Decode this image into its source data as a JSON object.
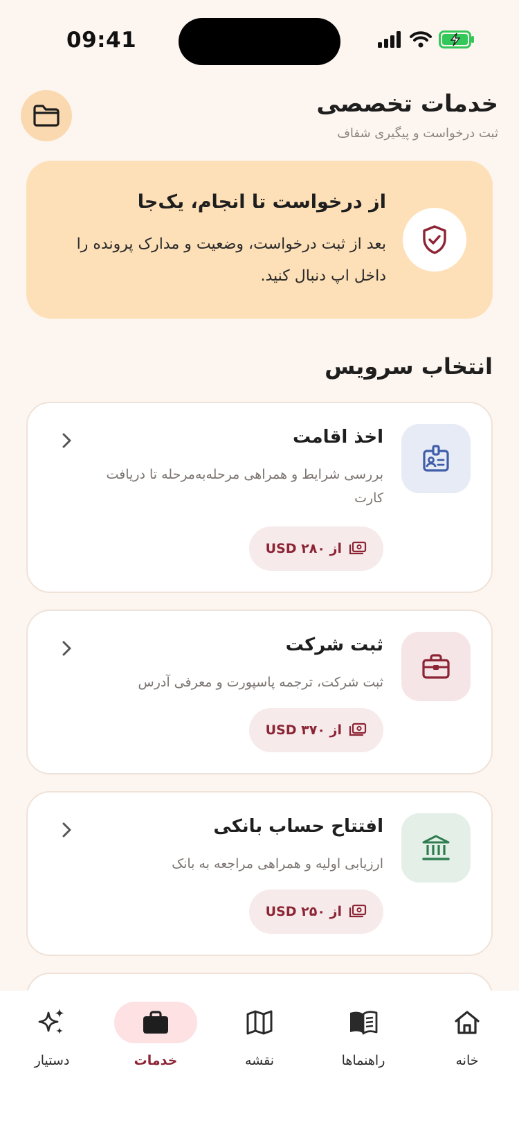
{
  "status": {
    "time": "09:41"
  },
  "header": {
    "title": "خدمات تخصصی",
    "subtitle": "ثبت درخواست و پیگیری شفاف"
  },
  "banner": {
    "title": "از درخواست تا انجام، یک‌جا",
    "text": "بعد از ثبت درخواست، وضعیت و مدارک پرونده را داخل اپ دنبال کنید."
  },
  "section_title": "انتخاب سرویس",
  "services": [
    {
      "title": "اخذ اقامت",
      "description": "بررسی شرایط و همراهی مرحله‌به‌مرحله تا دریافت کارت",
      "price": "از ۲۸۰ USD",
      "icon": "id-badge-icon",
      "icon_color": "#3f5da8",
      "icon_bg": "#e7ebf6"
    },
    {
      "title": "ثبت شرکت",
      "description": "ثبت شرکت، ترجمه پاسپورت و معرفی آدرس",
      "price": "از ۳۷۰ USD",
      "icon": "briefcase-icon",
      "icon_color": "#8c2434",
      "icon_bg": "#f6e5e7"
    },
    {
      "title": "افتتاح حساب بانکی",
      "description": "ارزیابی اولیه و همراهی مراجعه به بانک",
      "price": "از ۲۵۰ USD",
      "icon": "bank-icon",
      "icon_color": "#2e7d4f",
      "icon_bg": "#e4efe8"
    }
  ],
  "nav": {
    "home": "خانه",
    "guides": "راهنماها",
    "map": "نقشه",
    "services": "خدمات",
    "assistant": "دستیار"
  },
  "colors": {
    "accent": "#8c2434",
    "background": "#fdf5ef",
    "banner": "#fde0b8"
  }
}
